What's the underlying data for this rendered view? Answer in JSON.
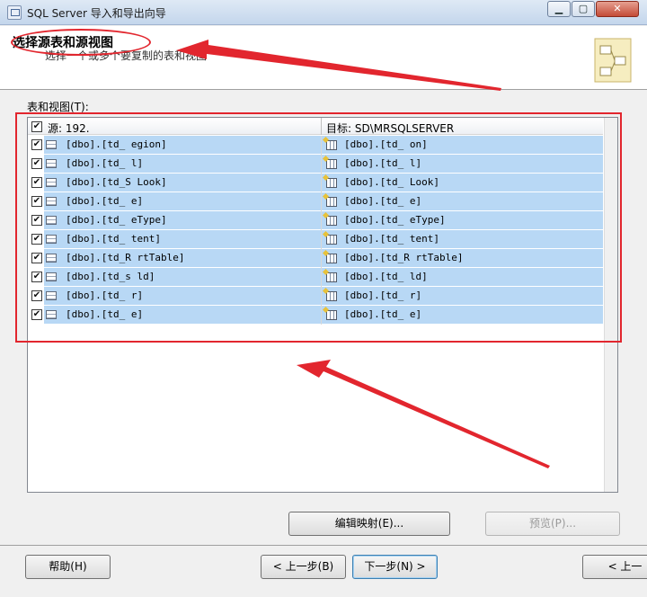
{
  "window": {
    "title": "SQL Server 导入和导出向导",
    "min_glyph": "▁",
    "max_glyph": "▢",
    "close_glyph": "✕"
  },
  "header": {
    "title": "选择源表和源视图",
    "subtitle": "选择一个或多个要复制的表和视图"
  },
  "tables_label": "表和视图(T):",
  "grid": {
    "source_header": "源: 192.",
    "dest_header": "目标: SD\\MRSQLSERVER",
    "rows": [
      {
        "checked": true,
        "source": "[dbo].[td_    egion]",
        "destination": "[dbo].[td_     on]"
      },
      {
        "checked": true,
        "source": "[dbo].[td_     l]",
        "destination": "[dbo].[td_     l]"
      },
      {
        "checked": true,
        "source": "[dbo].[td_S   Look]",
        "destination": "[dbo].[td_    Look]"
      },
      {
        "checked": true,
        "source": "[dbo].[td_    e]",
        "destination": "[dbo].[td_    e]"
      },
      {
        "checked": true,
        "source": "[dbo].[td_   eType]",
        "destination": "[dbo].[td_   eType]"
      },
      {
        "checked": true,
        "source": "[dbo].[td_    tent]",
        "destination": "[dbo].[td_    tent]"
      },
      {
        "checked": true,
        "source": "[dbo].[td_R   rtTable]",
        "destination": "[dbo].[td_R   rtTable]"
      },
      {
        "checked": true,
        "source": "[dbo].[td_s   ld]",
        "destination": "[dbo].[td_    ld]"
      },
      {
        "checked": true,
        "source": "[dbo].[td_    r]",
        "destination": "[dbo].[td_    r]"
      },
      {
        "checked": true,
        "source": "[dbo].[td_    e]",
        "destination": "[dbo].[td_    e]"
      }
    ]
  },
  "buttons": {
    "edit_mappings": "编辑映射(E)...",
    "preview": "预览(P)...",
    "help": "帮助(H)",
    "back": "< 上一步(B)",
    "next": "下一步(N) >",
    "back_partial": "< 上一"
  },
  "colors": {
    "annotation": "#e2262e",
    "row_selected": "#b8d8f5"
  }
}
